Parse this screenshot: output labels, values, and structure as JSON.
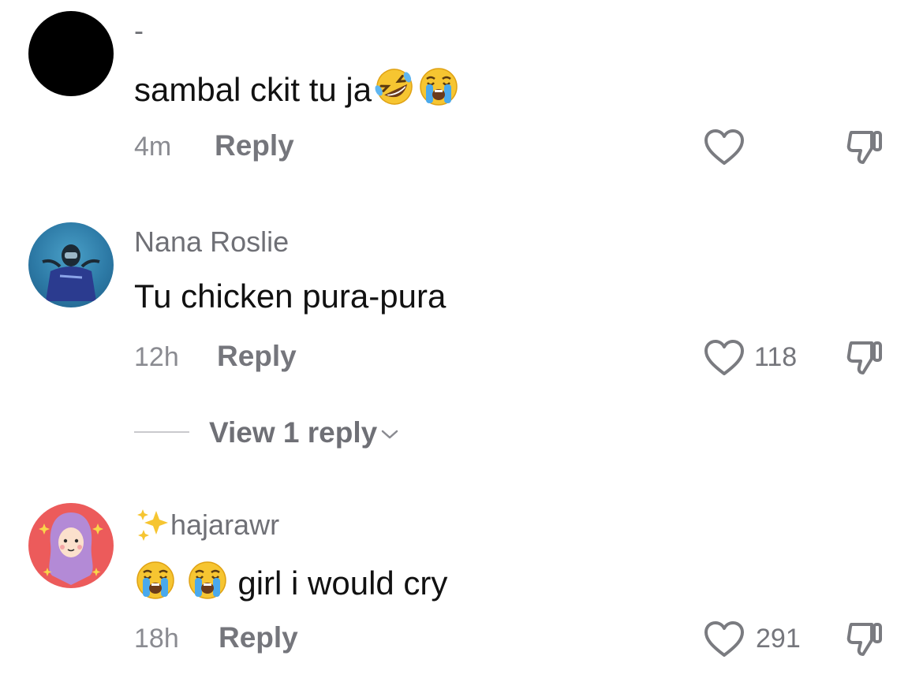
{
  "comments": [
    {
      "username": "-",
      "text": "sambal ckit tu ja",
      "text_emojis": [
        "rolling-on-floor-laughing",
        "loudly-crying"
      ],
      "time": "4m",
      "reply_label": "Reply",
      "likes": ""
    },
    {
      "username": "Nana Roslie",
      "text": "Tu chicken pura-pura",
      "time": "12h",
      "reply_label": "Reply",
      "likes": "118",
      "view_replies": "View 1 reply"
    },
    {
      "username_prefix_emoji": "sparkles",
      "username": "hajarawr",
      "text_prefix_emojis": [
        "loudly-crying",
        "loudly-crying"
      ],
      "text": "girl i would cry",
      "time": "18h",
      "reply_label": "Reply",
      "likes": "291"
    }
  ],
  "colors": {
    "secondary_text": "#75767c",
    "avatar1": "#000000",
    "avatar3_bg": "#ec5b5b",
    "hijab": "#b38ad6"
  }
}
